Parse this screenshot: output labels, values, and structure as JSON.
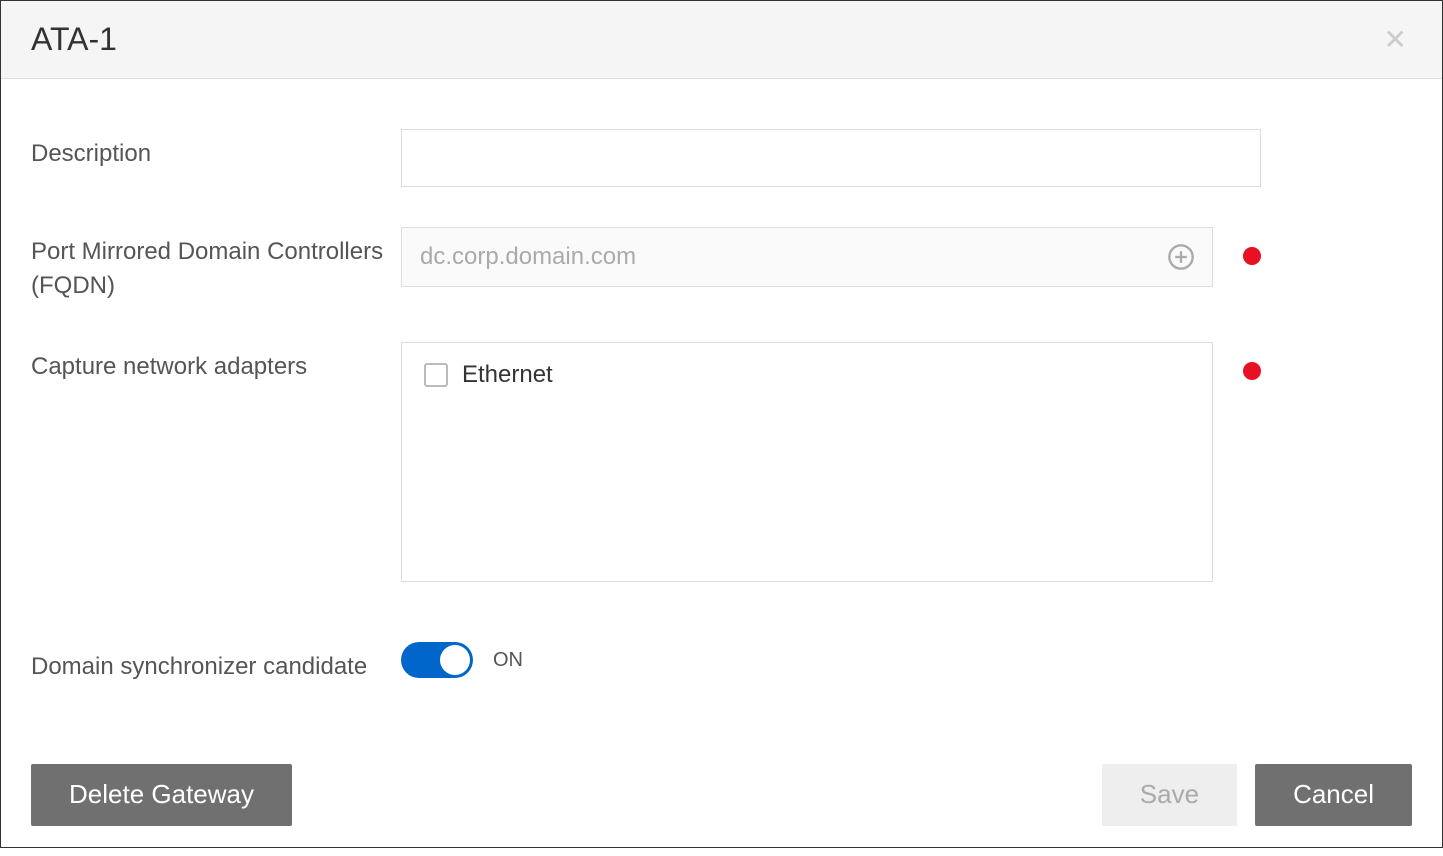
{
  "header": {
    "title": "ATA-1"
  },
  "form": {
    "description": {
      "label": "Description",
      "value": ""
    },
    "fqdn": {
      "label": "Port Mirrored Domain Controllers (FQDN)",
      "placeholder": "dc.corp.domain.com",
      "value": ""
    },
    "adapters": {
      "label": "Capture network adapters",
      "items": [
        {
          "name": "Ethernet",
          "checked": false
        }
      ]
    },
    "synchronizer": {
      "label": "Domain synchronizer candidate",
      "state": "ON",
      "on": true
    }
  },
  "footer": {
    "delete": "Delete Gateway",
    "save": "Save",
    "cancel": "Cancel"
  }
}
